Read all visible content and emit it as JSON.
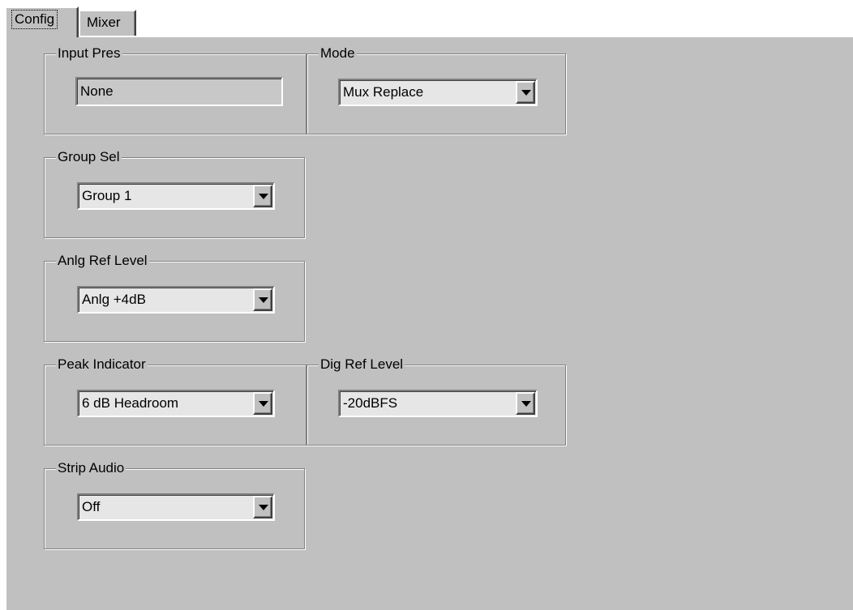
{
  "tabs": [
    {
      "label": "Config",
      "active": true
    },
    {
      "label": "Mixer",
      "active": false
    }
  ],
  "groups": {
    "input_pres": {
      "title": "Input Pres",
      "value": "None"
    },
    "mode": {
      "title": "Mode",
      "value": "Mux Replace"
    },
    "group_sel": {
      "title": "Group Sel",
      "value": "Group 1"
    },
    "anlg_ref_level": {
      "title": "Anlg Ref Level",
      "value": "Anlg +4dB"
    },
    "peak_indicator": {
      "title": "Peak Indicator",
      "value": "6 dB Headroom"
    },
    "dig_ref_level": {
      "title": "Dig Ref Level",
      "value": "-20dBFS"
    },
    "strip_audio": {
      "title": "Strip Audio",
      "value": "Off"
    }
  },
  "icons": {
    "dropdown_arrow": "chevron-down-icon"
  },
  "colors": {
    "panel_bg": "#c0c0c0",
    "field_bg": "#e6e6e6",
    "page_bg": "#ffffff"
  }
}
